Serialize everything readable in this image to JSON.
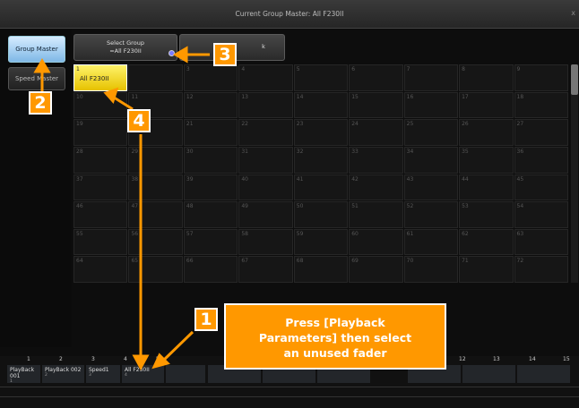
{
  "window": {
    "title": "Current Group Master: All F230II",
    "close_glyph": "x"
  },
  "left_buttons": {
    "group_master": "Group Master",
    "speed_master": "Speed Master"
  },
  "top_buttons": {
    "select_group_line1": "Select Group",
    "select_group_line2": "=All F230II",
    "back": "k"
  },
  "grid": {
    "active": {
      "number": "1",
      "name": "All F230II"
    },
    "rows": [
      [
        "",
        "",
        "3",
        "4",
        "5",
        "6",
        "7",
        "8",
        "9"
      ],
      [
        "10",
        "11",
        "12",
        "13",
        "14",
        "15",
        "16",
        "17",
        "18"
      ],
      [
        "19",
        "20",
        "21",
        "22",
        "23",
        "24",
        "25",
        "26",
        "27"
      ],
      [
        "28",
        "29",
        "30",
        "31",
        "32",
        "33",
        "34",
        "35",
        "36"
      ],
      [
        "37",
        "38",
        "39",
        "40",
        "41",
        "42",
        "43",
        "44",
        "45"
      ],
      [
        "46",
        "47",
        "48",
        "49",
        "50",
        "51",
        "52",
        "53",
        "54"
      ],
      [
        "55",
        "56",
        "57",
        "58",
        "59",
        "60",
        "61",
        "62",
        "63"
      ],
      [
        "64",
        "65",
        "66",
        "67",
        "68",
        "69",
        "70",
        "71",
        "72"
      ]
    ]
  },
  "faders": {
    "numbers": [
      "1",
      "2",
      "3",
      "4",
      "5",
      "12",
      "13",
      "14",
      "15"
    ],
    "items": [
      {
        "label": "PlayBack 001",
        "sub": "1"
      },
      {
        "label": "PlayBack 002",
        "sub": "2"
      },
      {
        "label": "Speed1",
        "sub": "3"
      },
      {
        "label": "All F230II",
        "sub": "4"
      }
    ]
  },
  "annotations": {
    "step1": "1",
    "step2": "2",
    "step3": "3",
    "step4": "4",
    "callout_line1": "Press [Playback",
    "callout_line2": "Parameters] then select",
    "callout_line3": "an unused fader"
  },
  "colors": {
    "accent_orange": "#ff9800",
    "active_group_yellow": "#f2d400",
    "selected_button_blue": "#9fcfff"
  }
}
